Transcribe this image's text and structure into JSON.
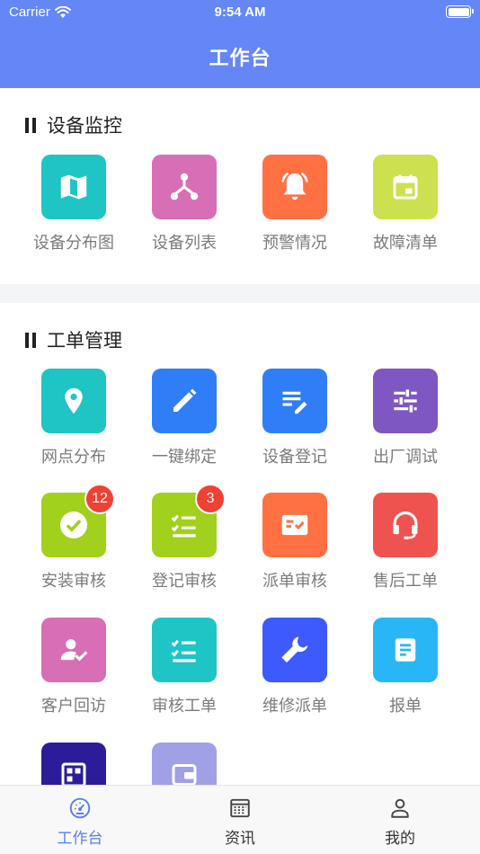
{
  "status_bar": {
    "carrier": "Carrier",
    "time": "9:54 AM"
  },
  "header": {
    "title": "工作台"
  },
  "sections": [
    {
      "title": "设备监控",
      "items": [
        {
          "label": "设备分布图",
          "icon": "map-icon",
          "color": "#1fc4c4"
        },
        {
          "label": "设备列表",
          "icon": "hierarchy-icon",
          "color": "#d86eb5"
        },
        {
          "label": "预警情况",
          "icon": "alarm-bell-icon",
          "color": "#ff7043"
        },
        {
          "label": "故障清单",
          "icon": "calendar-icon",
          "color": "#cde04f"
        }
      ]
    },
    {
      "title": "工单管理",
      "items": [
        {
          "label": "网点分布",
          "icon": "location-pin-icon",
          "color": "#1fc4c4"
        },
        {
          "label": "一键绑定",
          "icon": "pencil-icon",
          "color": "#2f7ef7"
        },
        {
          "label": "设备登记",
          "icon": "edit-notes-icon",
          "color": "#2f7ef7"
        },
        {
          "label": "出厂调试",
          "icon": "sliders-icon",
          "color": "#7e57c2"
        },
        {
          "label": "安装审核",
          "icon": "check-circle-icon",
          "color": "#a1d01d",
          "badge": "12"
        },
        {
          "label": "登记审核",
          "icon": "checklist-icon",
          "color": "#a1d01d",
          "badge": "3"
        },
        {
          "label": "派单审核",
          "icon": "check-card-icon",
          "color": "#ff7043"
        },
        {
          "label": "售后工单",
          "icon": "headset-icon",
          "color": "#ef5350"
        },
        {
          "label": "客户回访",
          "icon": "user-check-icon",
          "color": "#d86eb5"
        },
        {
          "label": "审核工单",
          "icon": "checklist-icon",
          "color": "#1fc4c4"
        },
        {
          "label": "维修派单",
          "icon": "wrench-icon",
          "color": "#3d5afe"
        },
        {
          "label": "报单",
          "icon": "document-icon",
          "color": "#29b6f6"
        },
        {
          "label": "",
          "icon": "grid-panel-icon",
          "color": "#2c1c99"
        },
        {
          "label": "",
          "icon": "wallet-icon",
          "color": "#9fa0e6"
        }
      ]
    }
  ],
  "tabbar": {
    "items": [
      {
        "label": "工作台",
        "icon": "dashboard-gauge-icon",
        "active": true
      },
      {
        "label": "资讯",
        "icon": "news-icon",
        "active": false
      },
      {
        "label": "我的",
        "icon": "person-icon",
        "active": false
      }
    ],
    "active_color": "#5b7ef0"
  }
}
